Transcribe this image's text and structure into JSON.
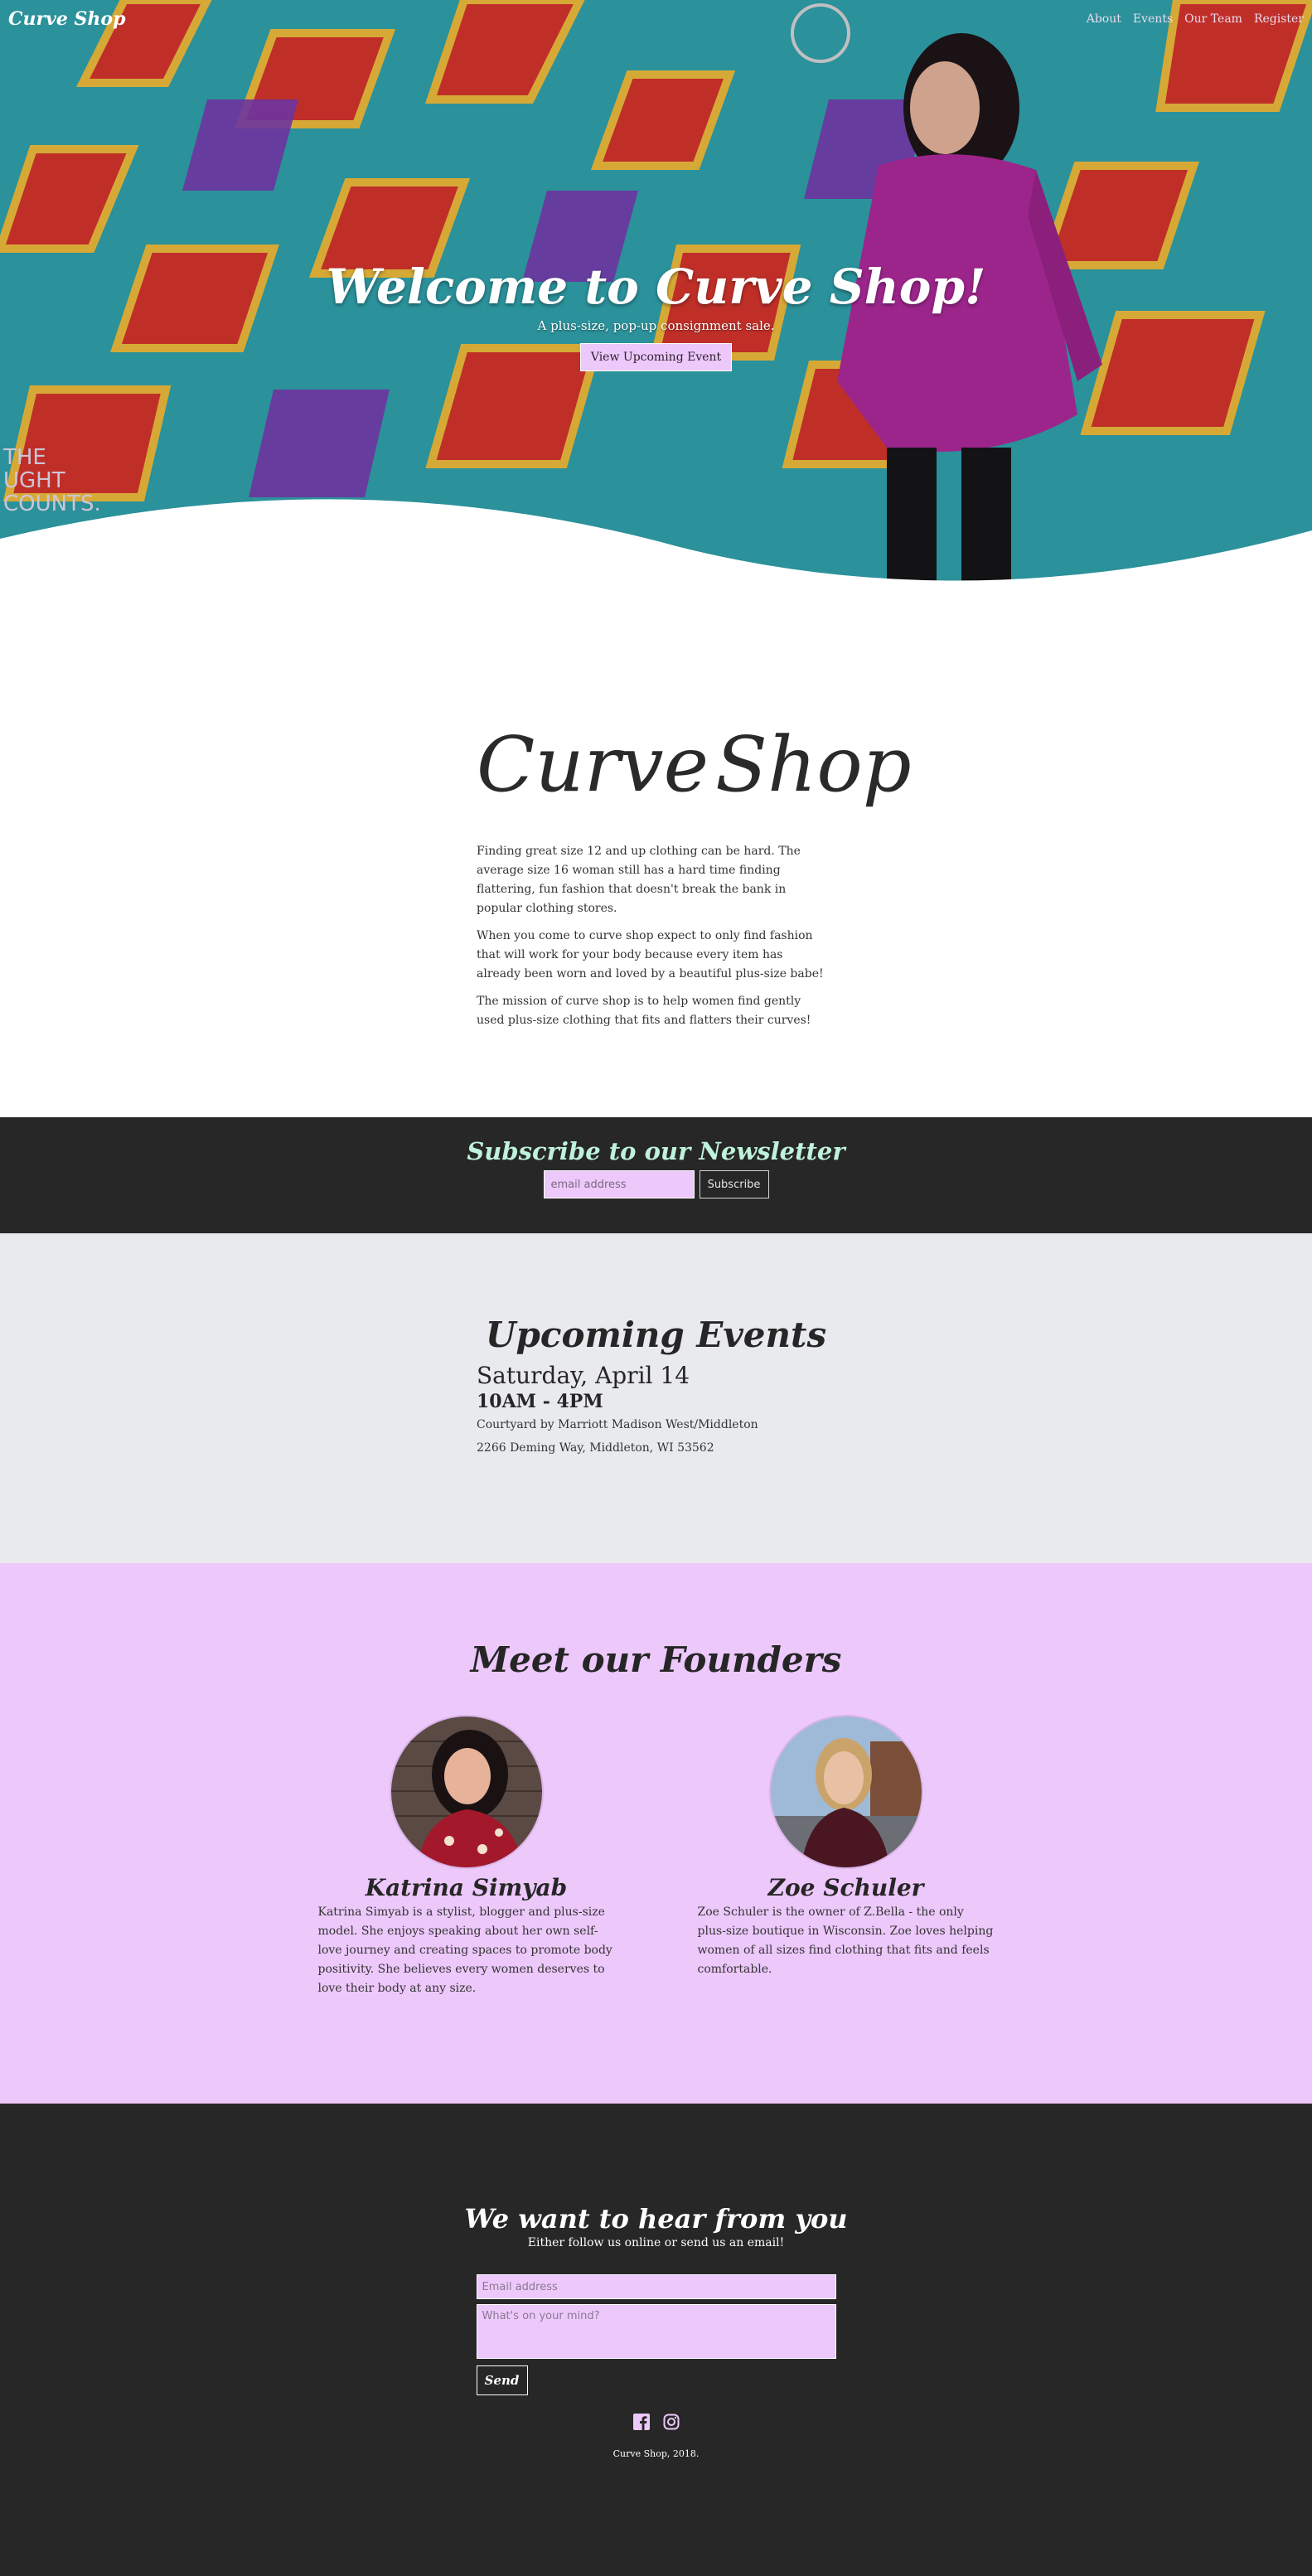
{
  "nav": {
    "brand": "Curve Shop",
    "links": [
      "About",
      "Events",
      "Our Team",
      "Register"
    ]
  },
  "hero": {
    "title": "Welcome to Curve Shop!",
    "subtitle": "A plus-size, pop-up consignment sale.",
    "button": "View Upcoming Event"
  },
  "about": {
    "logo_left": "Curve",
    "logo_right": "Shop",
    "paragraphs": [
      "Finding great size 12 and up clothing can be hard. The average size 16 woman still has a hard time finding flattering, fun fashion that doesn't break the bank in popular clothing stores.",
      "When you come to curve shop expect to only find fashion that will work for your body because every item has already been worn and loved by a beautiful plus-size babe!",
      "The mission of curve shop is to help women find gently used plus-size clothing that fits and flatters their curves!"
    ]
  },
  "newsletter": {
    "title": "Subscribe to our Newsletter",
    "placeholder": "email address",
    "button": "Subscribe"
  },
  "events": {
    "title": "Upcoming Events",
    "date": "Saturday, April 14",
    "time": "10AM - 4PM",
    "venue": "Courtyard by Marriott Madison West/Middleton",
    "address": "2266 Deming Way, Middleton, WI 53562"
  },
  "founders": {
    "title": "Meet our Founders",
    "people": [
      {
        "name": "Katrina Simyab",
        "bio": "Katrina Simyab is a stylist, blogger and plus-size model. She enjoys speaking about her own self-love journey and creating spaces to promote body positivity. She believes every women deserves to love their body at any size."
      },
      {
        "name": "Zoe Schuler",
        "bio": "Zoe Schuler is the owner of Z.Bella - the only plus-size boutique in Wisconsin. Zoe loves helping women of all sizes find clothing that fits and feels comfortable."
      }
    ]
  },
  "contact": {
    "title": "We want to hear from you",
    "subtitle": "Either follow us online or send us an email!",
    "email_placeholder": "Email address",
    "message_placeholder": "What's on your mind?",
    "send": "Send",
    "social_icons": [
      "facebook-icon",
      "instagram-icon"
    ],
    "copyright": "Curve Shop, 2018."
  },
  "colors": {
    "accent_lavender": "#edc8fb",
    "dark": "#272727",
    "events_bg": "#e9eaee",
    "mint": "#bff2da"
  }
}
